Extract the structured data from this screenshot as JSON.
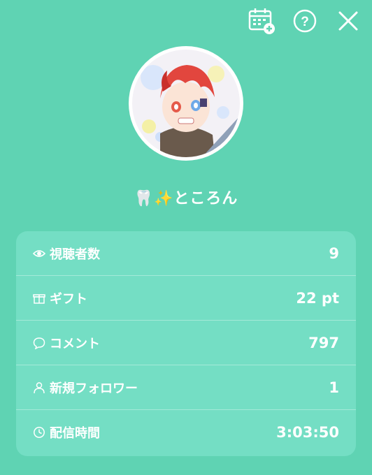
{
  "header": {
    "icons": [
      "calendar-add-icon",
      "help-icon",
      "close-icon"
    ]
  },
  "streamer": {
    "name": "🦷✨ところん"
  },
  "stats": [
    {
      "icon": "eye-icon",
      "label": "視聴者数",
      "value": "9"
    },
    {
      "icon": "gift-icon",
      "label": "ギフト",
      "value": "22 pt"
    },
    {
      "icon": "comment-icon",
      "label": "コメント",
      "value": "797"
    },
    {
      "icon": "person-icon",
      "label": "新規フォロワー",
      "value": "1"
    },
    {
      "icon": "clock-icon",
      "label": "配信時間",
      "value": "3:03:50"
    }
  ],
  "colors": {
    "background": "#5fd3b3",
    "card": "#74dec4",
    "text": "#ffffff"
  }
}
